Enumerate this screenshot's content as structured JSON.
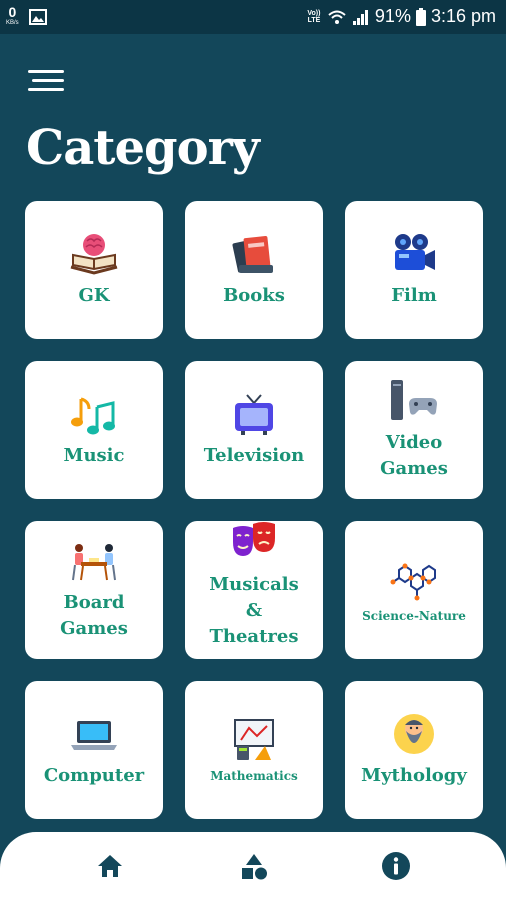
{
  "status_bar": {
    "net_speed": "0",
    "net_unit": "KB/s",
    "volte": "Vo)) LTE",
    "battery": "91%",
    "time": "3:16 pm"
  },
  "page": {
    "title": "Category"
  },
  "categories": [
    {
      "label": "GK",
      "icon": "brain-book-icon"
    },
    {
      "label": "Books",
      "icon": "books-icon"
    },
    {
      "label": "Film",
      "icon": "film-camera-icon"
    },
    {
      "label": "Music",
      "icon": "music-notes-icon"
    },
    {
      "label": "Television",
      "icon": "television-icon"
    },
    {
      "label": "Video\nGames",
      "icon": "game-console-icon"
    },
    {
      "label": "Board\nGames",
      "icon": "board-game-players-icon"
    },
    {
      "label": "Musicals\n&\nTheatres",
      "icon": "theatre-masks-icon"
    },
    {
      "label": "Science-Nature",
      "icon": "molecule-icon"
    },
    {
      "label": "Computer",
      "icon": "laptop-icon"
    },
    {
      "label": "Mathematics",
      "icon": "math-board-icon"
    },
    {
      "label": "Mythology",
      "icon": "sage-icon"
    }
  ],
  "bottom_nav": {
    "items": [
      {
        "icon": "home-icon"
      },
      {
        "icon": "shapes-icon"
      },
      {
        "icon": "info-icon"
      }
    ]
  },
  "colors": {
    "background": "#13475a",
    "status_bar": "#0c3545",
    "label_green": "#1a9276",
    "nav_icon": "#13475a"
  }
}
